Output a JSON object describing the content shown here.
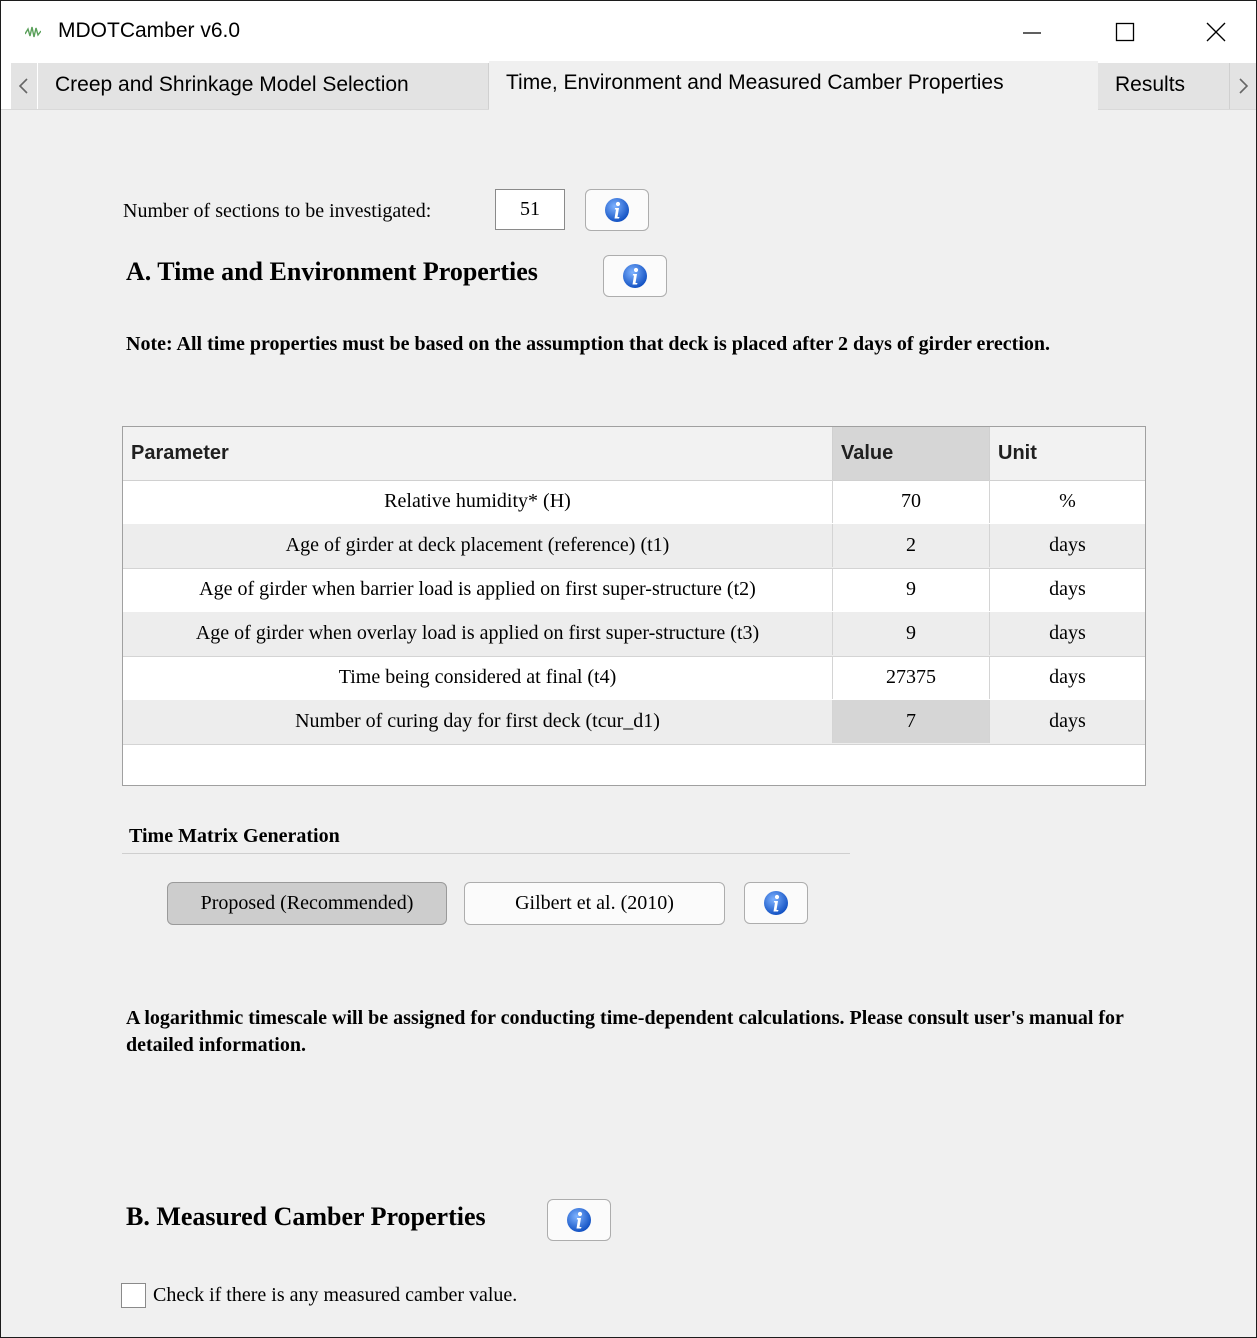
{
  "window": {
    "title": "MDOTCamber v6.0",
    "icon": "app-logo-icon",
    "controls": [
      "minimize-icon",
      "maximize-icon",
      "close-icon"
    ]
  },
  "tabs": [
    {
      "label": "Creep and Shrinkage Model Selection",
      "active": false
    },
    {
      "label": "Time, Environment and Measured Camber Properties",
      "active": true
    },
    {
      "label": "Results",
      "active": false
    }
  ],
  "sections": {
    "label": "Number of sections to be investigated:",
    "value": "51"
  },
  "section_a": {
    "heading": "A. Time and Environment Properties",
    "note": "Note: All time properties must be based on the assumption that deck is placed after 2 days of girder erection."
  },
  "table": {
    "headers": {
      "parameter": "Parameter",
      "value": "Value",
      "unit": "Unit"
    },
    "rows": [
      {
        "parameter": "Relative humidity* (H)",
        "value": "70",
        "unit": "%"
      },
      {
        "parameter": "Age of girder at deck placement (reference) (t1)",
        "value": "2",
        "unit": "days"
      },
      {
        "parameter": "Age of girder when barrier load is applied on first super-structure (t2)",
        "value": "9",
        "unit": "days"
      },
      {
        "parameter": "Age of girder when overlay load is applied on first super-structure (t3)",
        "value": "9",
        "unit": "days"
      },
      {
        "parameter": "Time being considered at final (t4)",
        "value": "27375",
        "unit": "days"
      },
      {
        "parameter": "Number of curing day for first deck (tcur_d1)",
        "value": "7",
        "unit": "days"
      }
    ]
  },
  "time_matrix": {
    "heading": "Time Matrix Generation",
    "buttons": {
      "proposed": "Proposed (Recommended)",
      "gilbert": "Gilbert et al. (2010)"
    },
    "selected": "proposed",
    "message": "A logarithmic timescale will be assigned for conducting time-dependent calculations. Please consult user's manual for detailed information."
  },
  "section_b": {
    "heading": "B. Measured Camber Properties",
    "checkbox_label": "Check if there is any measured camber value.",
    "checked": false
  },
  "colors": {
    "info_blue": "#1a5fd0",
    "selected_gray": "#d6d6d6",
    "background": "#f0f0f0"
  }
}
